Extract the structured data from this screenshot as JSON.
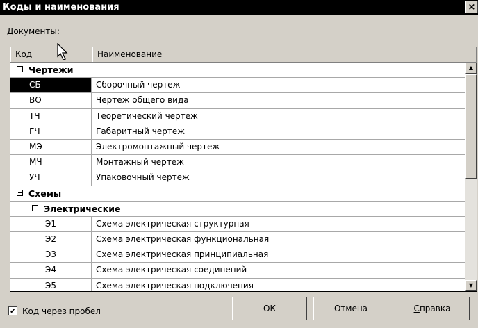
{
  "window": {
    "title": "Коды и наименования",
    "close": "×"
  },
  "documents_label": "Документы:",
  "columns": {
    "code": "Код",
    "name": "Наименование"
  },
  "rows": [
    {
      "type": "group",
      "label": "Чертежи"
    },
    {
      "type": "item",
      "code": "СБ",
      "name": "Сборочный чертеж",
      "selected": true
    },
    {
      "type": "item",
      "code": "ВО",
      "name": "Чертеж общего вида"
    },
    {
      "type": "item",
      "code": "ТЧ",
      "name": "Теоретический чертеж"
    },
    {
      "type": "item",
      "code": "ГЧ",
      "name": "Габаритный чертеж"
    },
    {
      "type": "item",
      "code": "МЭ",
      "name": "Электромонтажный чертеж"
    },
    {
      "type": "item",
      "code": "МЧ",
      "name": "Монтажный чертеж"
    },
    {
      "type": "item",
      "code": "УЧ",
      "name": "Упаковочный чертеж"
    },
    {
      "type": "group",
      "label": "Схемы"
    },
    {
      "type": "subgroup",
      "label": "Электрические"
    },
    {
      "type": "subitem",
      "code": "Э1",
      "name": "Схема электрическая структурная"
    },
    {
      "type": "subitem",
      "code": "Э2",
      "name": "Схема электрическая функциональная"
    },
    {
      "type": "subitem",
      "code": "Э3",
      "name": "Схема электрическая принципиальная"
    },
    {
      "type": "subitem",
      "code": "Э4",
      "name": "Схема электрическая соединений"
    },
    {
      "type": "subitem",
      "code": "Э5",
      "name": "Схема электрическая подключения"
    }
  ],
  "scroll": {
    "up": "▲",
    "down": "▼"
  },
  "checkbox": {
    "label_first": "К",
    "label_rest": "од через пробел",
    "checked_mark": "✔"
  },
  "buttons": {
    "ok": "ОК",
    "cancel": "Отмена",
    "help_first": "С",
    "help_rest": "правка"
  }
}
